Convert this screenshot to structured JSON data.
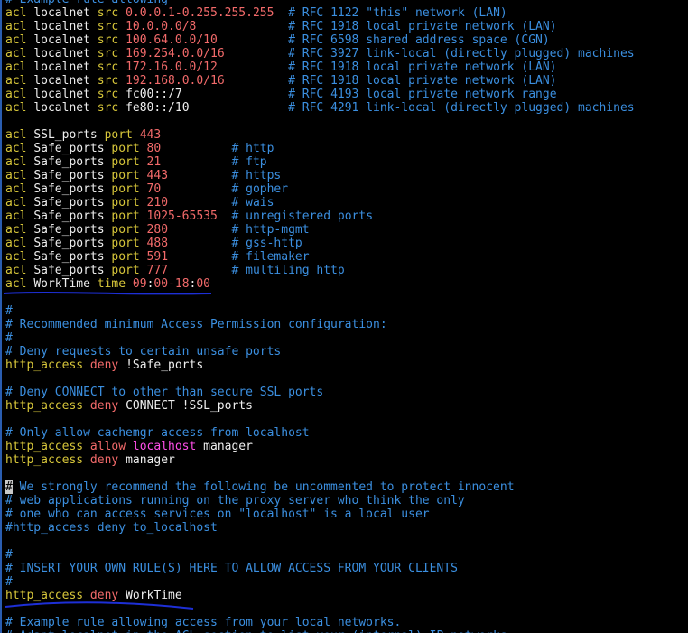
{
  "terminal": {
    "lines": [
      [
        {
          "t": "cmt",
          "s": "# Example rule allowing"
        }
      ],
      [
        {
          "t": "kw",
          "s": "acl "
        },
        {
          "t": "id",
          "s": "localnet "
        },
        {
          "t": "kw",
          "s": "src "
        },
        {
          "t": "num",
          "s": "0.0.0.1-0.255.255.255"
        },
        {
          "t": "cmt",
          "s": "  # RFC 1122 \"this\" network (LAN)"
        }
      ],
      [
        {
          "t": "kw",
          "s": "acl "
        },
        {
          "t": "id",
          "s": "localnet "
        },
        {
          "t": "kw",
          "s": "src "
        },
        {
          "t": "num",
          "s": "10.0.0.0/8"
        },
        {
          "t": "cmt",
          "s": "             # RFC 1918 local private network (LAN)"
        }
      ],
      [
        {
          "t": "kw",
          "s": "acl "
        },
        {
          "t": "id",
          "s": "localnet "
        },
        {
          "t": "kw",
          "s": "src "
        },
        {
          "t": "num",
          "s": "100.64.0.0/10"
        },
        {
          "t": "cmt",
          "s": "          # RFC 6598 shared address space (CGN)"
        }
      ],
      [
        {
          "t": "kw",
          "s": "acl "
        },
        {
          "t": "id",
          "s": "localnet "
        },
        {
          "t": "kw",
          "s": "src "
        },
        {
          "t": "num",
          "s": "169.254.0.0/16"
        },
        {
          "t": "cmt",
          "s": "         # RFC 3927 link-local (directly plugged) machines"
        }
      ],
      [
        {
          "t": "kw",
          "s": "acl "
        },
        {
          "t": "id",
          "s": "localnet "
        },
        {
          "t": "kw",
          "s": "src "
        },
        {
          "t": "num",
          "s": "172.16.0.0/12"
        },
        {
          "t": "cmt",
          "s": "          # RFC 1918 local private network (LAN)"
        }
      ],
      [
        {
          "t": "kw",
          "s": "acl "
        },
        {
          "t": "id",
          "s": "localnet "
        },
        {
          "t": "kw",
          "s": "src "
        },
        {
          "t": "num",
          "s": "192.168.0.0/16"
        },
        {
          "t": "cmt",
          "s": "         # RFC 1918 local private network (LAN)"
        }
      ],
      [
        {
          "t": "kw",
          "s": "acl "
        },
        {
          "t": "id",
          "s": "localnet "
        },
        {
          "t": "kw",
          "s": "src "
        },
        {
          "t": "id",
          "s": "fc00::/7"
        },
        {
          "t": "cmt",
          "s": "               # RFC 4193 local private network range"
        }
      ],
      [
        {
          "t": "kw",
          "s": "acl "
        },
        {
          "t": "id",
          "s": "localnet "
        },
        {
          "t": "kw",
          "s": "src "
        },
        {
          "t": "id",
          "s": "fe80::/10"
        },
        {
          "t": "cmt",
          "s": "              # RFC 4291 link-local (directly plugged) machines"
        }
      ],
      [],
      [
        {
          "t": "kw",
          "s": "acl "
        },
        {
          "t": "id",
          "s": "SSL_ports "
        },
        {
          "t": "kw",
          "s": "port "
        },
        {
          "t": "num",
          "s": "443"
        }
      ],
      [
        {
          "t": "kw",
          "s": "acl "
        },
        {
          "t": "id",
          "s": "Safe_ports "
        },
        {
          "t": "kw",
          "s": "port "
        },
        {
          "t": "num",
          "s": "80"
        },
        {
          "t": "cmt",
          "s": "          # http"
        }
      ],
      [
        {
          "t": "kw",
          "s": "acl "
        },
        {
          "t": "id",
          "s": "Safe_ports "
        },
        {
          "t": "kw",
          "s": "port "
        },
        {
          "t": "num",
          "s": "21"
        },
        {
          "t": "cmt",
          "s": "          # ftp"
        }
      ],
      [
        {
          "t": "kw",
          "s": "acl "
        },
        {
          "t": "id",
          "s": "Safe_ports "
        },
        {
          "t": "kw",
          "s": "port "
        },
        {
          "t": "num",
          "s": "443"
        },
        {
          "t": "cmt",
          "s": "         # https"
        }
      ],
      [
        {
          "t": "kw",
          "s": "acl "
        },
        {
          "t": "id",
          "s": "Safe_ports "
        },
        {
          "t": "kw",
          "s": "port "
        },
        {
          "t": "num",
          "s": "70"
        },
        {
          "t": "cmt",
          "s": "          # gopher"
        }
      ],
      [
        {
          "t": "kw",
          "s": "acl "
        },
        {
          "t": "id",
          "s": "Safe_ports "
        },
        {
          "t": "kw",
          "s": "port "
        },
        {
          "t": "num",
          "s": "210"
        },
        {
          "t": "cmt",
          "s": "         # wais"
        }
      ],
      [
        {
          "t": "kw",
          "s": "acl "
        },
        {
          "t": "id",
          "s": "Safe_ports "
        },
        {
          "t": "kw",
          "s": "port "
        },
        {
          "t": "num",
          "s": "1025-65535"
        },
        {
          "t": "cmt",
          "s": "  # unregistered ports"
        }
      ],
      [
        {
          "t": "kw",
          "s": "acl "
        },
        {
          "t": "id",
          "s": "Safe_ports "
        },
        {
          "t": "kw",
          "s": "port "
        },
        {
          "t": "num",
          "s": "280"
        },
        {
          "t": "cmt",
          "s": "         # http-mgmt"
        }
      ],
      [
        {
          "t": "kw",
          "s": "acl "
        },
        {
          "t": "id",
          "s": "Safe_ports "
        },
        {
          "t": "kw",
          "s": "port "
        },
        {
          "t": "num",
          "s": "488"
        },
        {
          "t": "cmt",
          "s": "         # gss-http"
        }
      ],
      [
        {
          "t": "kw",
          "s": "acl "
        },
        {
          "t": "id",
          "s": "Safe_ports "
        },
        {
          "t": "kw",
          "s": "port "
        },
        {
          "t": "num",
          "s": "591"
        },
        {
          "t": "cmt",
          "s": "         # filemaker"
        }
      ],
      [
        {
          "t": "kw",
          "s": "acl "
        },
        {
          "t": "id",
          "s": "Safe_ports "
        },
        {
          "t": "kw",
          "s": "port "
        },
        {
          "t": "num",
          "s": "777"
        },
        {
          "t": "cmt",
          "s": "         # multiling http"
        }
      ],
      [
        {
          "t": "kw",
          "s": "acl "
        },
        {
          "t": "id",
          "s": "WorkTime "
        },
        {
          "t": "kw",
          "s": "time "
        },
        {
          "t": "num",
          "s": "09"
        },
        {
          "t": "id",
          "s": ":"
        },
        {
          "t": "num",
          "s": "00-18"
        },
        {
          "t": "id",
          "s": ":"
        },
        {
          "t": "num",
          "s": "00"
        }
      ],
      [],
      [
        {
          "t": "cmt",
          "s": "#"
        }
      ],
      [
        {
          "t": "cmt",
          "s": "# Recommended minimum Access Permission configuration:"
        }
      ],
      [
        {
          "t": "cmt",
          "s": "#"
        }
      ],
      [
        {
          "t": "cmt",
          "s": "# Deny requests to certain unsafe ports"
        }
      ],
      [
        {
          "t": "kw",
          "s": "http_access "
        },
        {
          "t": "num",
          "s": "deny "
        },
        {
          "t": "id",
          "s": "!Safe_ports"
        }
      ],
      [],
      [
        {
          "t": "cmt",
          "s": "# Deny CONNECT to other than secure SSL ports"
        }
      ],
      [
        {
          "t": "kw",
          "s": "http_access "
        },
        {
          "t": "num",
          "s": "deny "
        },
        {
          "t": "id",
          "s": "CONNECT !SSL_ports"
        }
      ],
      [],
      [
        {
          "t": "cmt",
          "s": "# Only allow cachemgr access from localhost"
        }
      ],
      [
        {
          "t": "kw",
          "s": "http_access "
        },
        {
          "t": "num",
          "s": "allow "
        },
        {
          "t": "hl",
          "s": "localhost "
        },
        {
          "t": "id",
          "s": "manager"
        }
      ],
      [
        {
          "t": "kw",
          "s": "http_access "
        },
        {
          "t": "num",
          "s": "deny "
        },
        {
          "t": "id",
          "s": "manager"
        }
      ],
      [],
      [
        {
          "t": "cursor",
          "s": "#"
        },
        {
          "t": "cmt",
          "s": " We strongly recommend the following be uncommented to protect innocent"
        }
      ],
      [
        {
          "t": "cmt",
          "s": "# web applications running on the proxy server who think the only"
        }
      ],
      [
        {
          "t": "cmt",
          "s": "# one who can access services on \"localhost\" is a local user"
        }
      ],
      [
        {
          "t": "cmt",
          "s": "#http_access deny to_localhost"
        }
      ],
      [],
      [
        {
          "t": "cmt",
          "s": "#"
        }
      ],
      [
        {
          "t": "cmt",
          "s": "# INSERT YOUR OWN RULE(S) HERE TO ALLOW ACCESS FROM YOUR CLIENTS"
        }
      ],
      [
        {
          "t": "cmt",
          "s": "#"
        }
      ],
      [
        {
          "t": "kw",
          "s": "http_access "
        },
        {
          "t": "num",
          "s": "deny "
        },
        {
          "t": "id",
          "s": "WorkTime"
        }
      ],
      [],
      [
        {
          "t": "cmt",
          "s": "# Example rule allowing access from your local networks."
        }
      ],
      [
        {
          "t": "cmt",
          "s": "# Adapt localnet in the ACL section to list your (internal) IP networks"
        }
      ]
    ]
  },
  "colors": {
    "background": "#000000",
    "keyword": "#d7c63a",
    "number": "#f26a6a",
    "identifier": "#eeeeee",
    "comment": "#3b8fe0",
    "highlight": "#ff4fe8",
    "annotation_underline": "#1d2fd6"
  }
}
